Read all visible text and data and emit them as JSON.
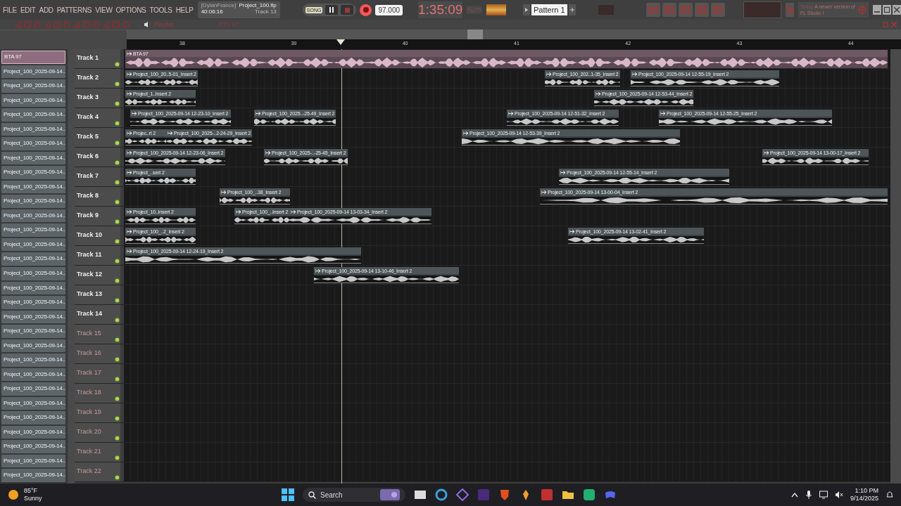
{
  "menu": [
    "FILE",
    "EDIT",
    "ADD",
    "PATTERNS",
    "VIEW",
    "OPTIONS",
    "TOOLS",
    "HELP"
  ],
  "song_info": {
    "user": "[DylanFrance]",
    "file": "Project_100.flp",
    "time": "40:06:16",
    "hint": "Track 13"
  },
  "transport": {
    "mode": "SONG",
    "tempo": "97.000",
    "clock": "1:35:09"
  },
  "pattern": "Pattern 1",
  "news": {
    "label": "Today",
    "text": "A newer version of FL Studio i"
  },
  "playlist": {
    "title": "Playlist",
    "clip_source": "BTA 97"
  },
  "ruler": [
    "38",
    "39",
    "40",
    "41",
    "42",
    "43",
    "44"
  ],
  "picker": [
    {
      "label": "BTA 97",
      "selected": true
    },
    {
      "label": "Project_100_2025-09-14..",
      "selected": false
    },
    {
      "label": "Project_100_2025-09-14..",
      "selected": false
    },
    {
      "label": "Project_100_2025-09-14..",
      "selected": false
    },
    {
      "label": "Project_100_2025-09-14..",
      "selected": false
    },
    {
      "label": "Project_100_2025-09-14..",
      "selected": false
    },
    {
      "label": "Project_100_2025-09-14..",
      "selected": false
    },
    {
      "label": "Project_100_2025-09-14..",
      "selected": false
    },
    {
      "label": "Project_100_2025-09-14..",
      "selected": false
    },
    {
      "label": "Project_100_2025-09-14..",
      "selected": false
    },
    {
      "label": "Project_100_2025-09-14..",
      "selected": false
    },
    {
      "label": "Project_100_2025-09-14..",
      "selected": false
    },
    {
      "label": "Project_100_2025-09-14..",
      "selected": false
    },
    {
      "label": "Project_100_2025-09-14..",
      "selected": false
    },
    {
      "label": "Project_100_2025-09-14..",
      "selected": false
    },
    {
      "label": "Project_100_2025-09-14..",
      "selected": false
    },
    {
      "label": "Project_100_2025-09-14..",
      "selected": false
    },
    {
      "label": "Project_100_2025-09-14..",
      "selected": false
    },
    {
      "label": "Project_100_2025-09-14..",
      "selected": false
    },
    {
      "label": "Project_100_2025-09-14..",
      "selected": false
    },
    {
      "label": "Project_100_2025-09-14..",
      "selected": false
    },
    {
      "label": "Project_100_2025-09-14..",
      "selected": false
    },
    {
      "label": "Project_100_2025-09-14..",
      "selected": false
    },
    {
      "label": "Project_100_2025-09-14..",
      "selected": false
    },
    {
      "label": "Project_100_2025-09-14..",
      "selected": false
    },
    {
      "label": "Project_100_2025-09-14..",
      "selected": false
    },
    {
      "label": "Project_100_2025-09-14..",
      "selected": false
    },
    {
      "label": "Project_100_2025-09-14..",
      "selected": false
    },
    {
      "label": "Project_100_2025-09-14..",
      "selected": false
    },
    {
      "label": "Project_100_2025-09-14..",
      "selected": false
    }
  ],
  "tracks": [
    {
      "name": "Track 1",
      "dimmed": false,
      "clips": [
        {
          "kind": "source",
          "label": "BTA 97"
        }
      ]
    },
    {
      "name": "Track 2",
      "dimmed": false,
      "clips": [
        {
          "kind": "insert",
          "label": "Project_100_20..5-01_Insert 2"
        },
        {
          "kind": "insert",
          "label": "Project_100_202..1-35_Insert 2"
        },
        {
          "kind": "insert",
          "label": "Project_100_2025-09-14 12-55-19_Insert 2"
        }
      ]
    },
    {
      "name": "Track 3",
      "dimmed": false,
      "clips": [
        {
          "kind": "insert",
          "label": "Project_1..Insert 2"
        },
        {
          "kind": "insert",
          "label": "Project_100_2025-09-14 12-53-44_Insert 2"
        }
      ]
    },
    {
      "name": "Track 4",
      "dimmed": false,
      "clips": [
        {
          "kind": "insert",
          "label": "Project_100_2025-09-14 12-23-10_Insert 2"
        },
        {
          "kind": "insert",
          "label": "Project_100_2025..-25-49_Insert 2"
        },
        {
          "kind": "insert",
          "label": "Project_100_2025-09-14 12-51-32_Insert 2"
        },
        {
          "kind": "insert",
          "label": "Project_100_2025-09-14 12-55-25_Insert 2"
        }
      ]
    },
    {
      "name": "Track 5",
      "dimmed": false,
      "clips": [
        {
          "kind": "insert",
          "label": "Projec..rt 2"
        },
        {
          "kind": "insert",
          "label": "Project_100_2025-..2-24-29_Insert 2"
        },
        {
          "kind": "insert",
          "label": "Project_100_2025-09-14 12-53-39_Insert 2"
        }
      ]
    },
    {
      "name": "Track 6",
      "dimmed": false,
      "clips": [
        {
          "kind": "insert",
          "label": "Project_100_2025-09-14 12-23-06_Insert 2"
        },
        {
          "kind": "insert",
          "label": "Project_100_2025-..-25-45_Insert 2"
        },
        {
          "kind": "insert",
          "label": "Project_100_2025-09-14 13-00-17_Insert 2"
        }
      ]
    },
    {
      "name": "Track 7",
      "dimmed": false,
      "clips": [
        {
          "kind": "insert",
          "label": "Project_..sert 2"
        },
        {
          "kind": "insert",
          "label": "Project_100_2025-09-14 12-55-14_Insert 2"
        }
      ]
    },
    {
      "name": "Track 8",
      "dimmed": false,
      "clips": [
        {
          "kind": "insert",
          "label": "Project_100_..38_Insert 2"
        },
        {
          "kind": "insert",
          "label": "Project_100_2025-09-14 13-00-04_Insert 2"
        }
      ]
    },
    {
      "name": "Track 9",
      "dimmed": false,
      "clips": [
        {
          "kind": "insert",
          "label": "Project_10..Insert 2"
        },
        {
          "kind": "insert",
          "label": "Project_100_..Insert 2"
        },
        {
          "kind": "insert",
          "label": "Project_100_2025-09-14 13-03-34_Insert 2"
        }
      ]
    },
    {
      "name": "Track 10",
      "dimmed": false,
      "clips": [
        {
          "kind": "insert",
          "label": "Project_100_..2_Insert 2"
        },
        {
          "kind": "insert",
          "label": "Project_100_2025-09-14 13-02-41_Insert 2"
        }
      ]
    },
    {
      "name": "Track 11",
      "dimmed": false,
      "clips": [
        {
          "kind": "insert",
          "label": "Project_100_2025-09-14 12-24-19_Insert 2"
        }
      ]
    },
    {
      "name": "Track 12",
      "dimmed": false,
      "clips": [
        {
          "kind": "insert",
          "label": "Project_100_2025-09-14 13-10-46_Insert 2"
        }
      ]
    },
    {
      "name": "Track 13",
      "dimmed": false
    },
    {
      "name": "Track 14",
      "dimmed": false
    },
    {
      "name": "Track 15",
      "dimmed": true
    },
    {
      "name": "Track 16",
      "dimmed": true
    },
    {
      "name": "Track 17",
      "dimmed": true
    },
    {
      "name": "Track 18",
      "dimmed": true
    },
    {
      "name": "Track 19",
      "dimmed": true
    },
    {
      "name": "Track 20",
      "dimmed": true
    },
    {
      "name": "Track 21",
      "dimmed": true
    },
    {
      "name": "Track 22",
      "dimmed": true
    }
  ],
  "taskbar": {
    "temperature": "85°F",
    "weather": "Sunny",
    "search": "Search",
    "time": "1:10 PM",
    "date": "9/14/2025"
  }
}
